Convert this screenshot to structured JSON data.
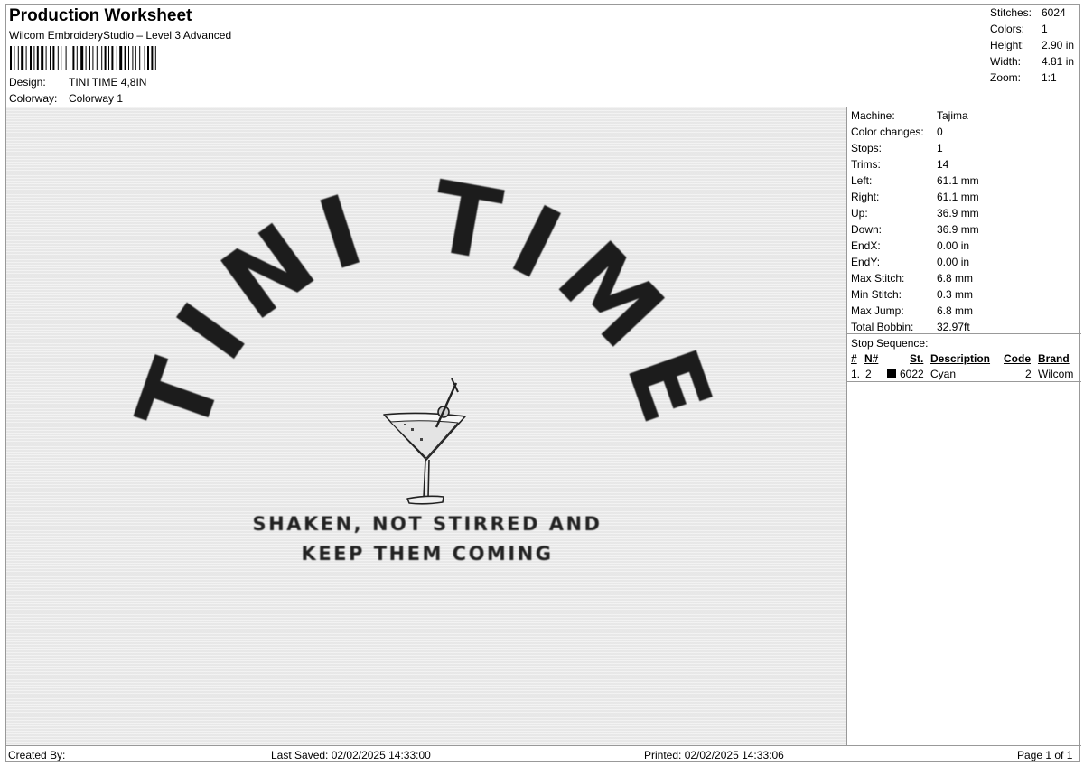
{
  "header": {
    "title": "Production Worksheet",
    "subtitle": "Wilcom EmbroideryStudio – Level 3 Advanced",
    "design_label": "Design:",
    "design_value": "TINI TIME 4,8IN",
    "colorway_label": "Colorway:",
    "colorway_value": "Colorway 1"
  },
  "stats": [
    {
      "label": "Stitches:",
      "value": "6024"
    },
    {
      "label": "Colors:",
      "value": "1"
    },
    {
      "label": "Height:",
      "value": "2.90 in"
    },
    {
      "label": "Width:",
      "value": "4.81 in"
    },
    {
      "label": "Zoom:",
      "value": "1:1"
    }
  ],
  "design": {
    "line1": "TINI TIME",
    "line2": "SHAKEN, NOT STIRRED AND",
    "line3": "KEEP THEM COMING",
    "thread_color": "#1a1a1a"
  },
  "machine_info": [
    {
      "label": "Machine:",
      "value": "Tajima"
    },
    {
      "label": "Color changes:",
      "value": "0"
    },
    {
      "label": "Stops:",
      "value": "1"
    },
    {
      "label": "Trims:",
      "value": "14"
    },
    {
      "label": "Left:",
      "value": "61.1 mm"
    },
    {
      "label": "Right:",
      "value": "61.1 mm"
    },
    {
      "label": "Up:",
      "value": "36.9 mm"
    },
    {
      "label": "Down:",
      "value": "36.9 mm"
    },
    {
      "label": "EndX:",
      "value": "0.00 in"
    },
    {
      "label": "EndY:",
      "value": "0.00 in"
    },
    {
      "label": "Max Stitch:",
      "value": "6.8 mm"
    },
    {
      "label": "Min Stitch:",
      "value": "0.3 mm"
    },
    {
      "label": "Max Jump:",
      "value": "6.8 mm"
    },
    {
      "label": "Total Bobbin:",
      "value": "32.97ft"
    }
  ],
  "stop_sequence": {
    "label": "Stop Sequence:",
    "headers": {
      "num": "#",
      "n": "N#",
      "st": "St.",
      "description": "Description",
      "code": "Code",
      "brand": "Brand"
    },
    "row": {
      "num": "1.",
      "n": "2",
      "st": "6022",
      "description": "Cyan",
      "code": "2",
      "brand": "Wilcom",
      "swatch_color": "#000000"
    }
  },
  "footer": {
    "created_by": "Created By:",
    "last_saved": "Last Saved: 02/02/2025 14:33:00",
    "printed": "Printed: 02/02/2025 14:33:06",
    "page": "Page 1 of 1"
  }
}
